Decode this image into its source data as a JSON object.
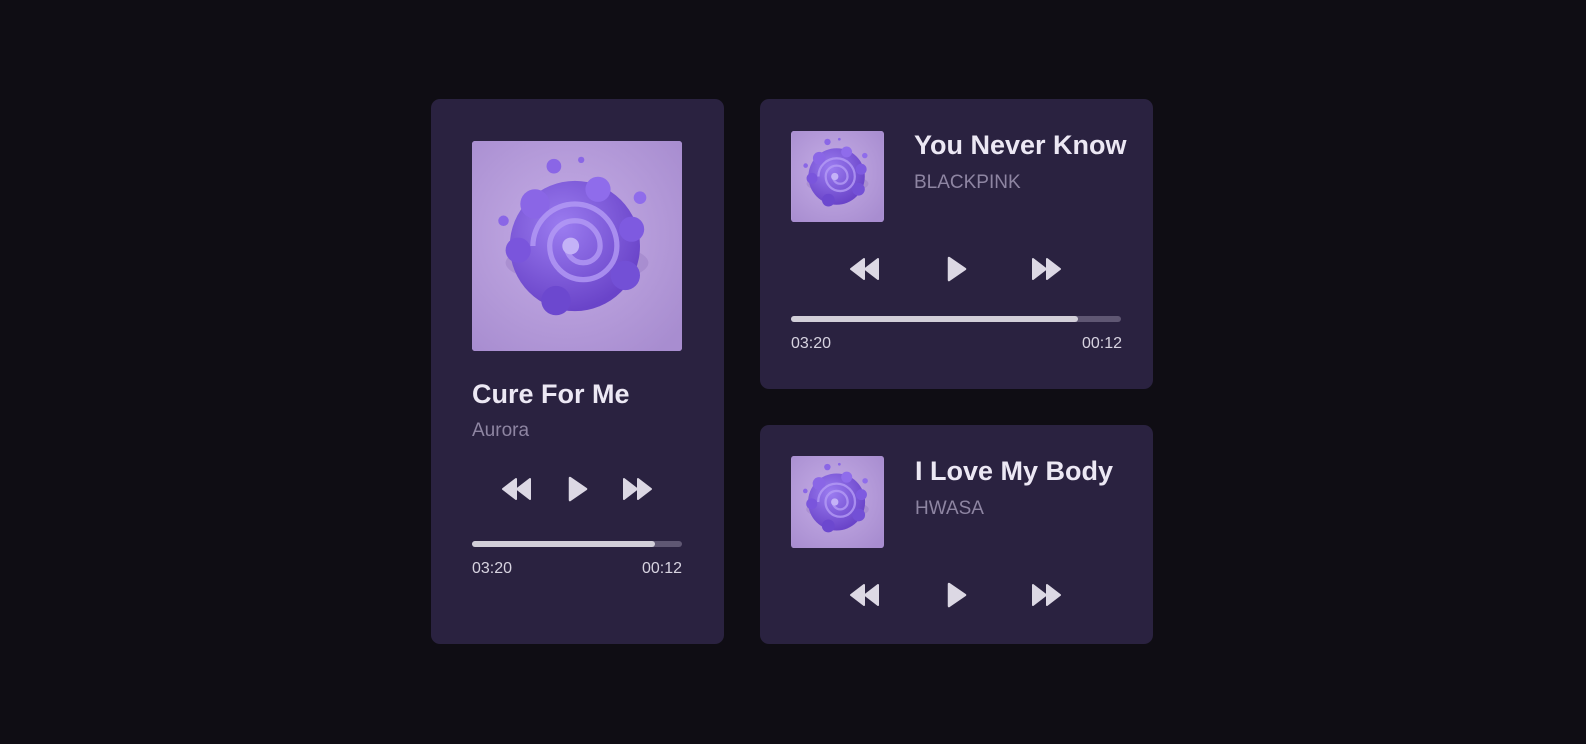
{
  "colors": {
    "background": "#0f0d14",
    "card": "#2a2240",
    "title": "#ece8f4",
    "artist": "#8e85a2",
    "progress_fill": "#d2cfd9",
    "progress_track": "#5f5773",
    "art": "#b9a0dc"
  },
  "players": [
    {
      "title": "Cure For Me",
      "artist": "Aurora",
      "art_icon": "purple-swirl-album-art",
      "controls": [
        "rewind-icon",
        "play-icon",
        "fast-forward-icon"
      ],
      "progress": 0.87,
      "time_left": "03:20",
      "time_right": "00:12"
    },
    {
      "title": "You Never Know",
      "artist": "BLACKPINK",
      "art_icon": "purple-swirl-album-art",
      "controls": [
        "rewind-icon",
        "play-icon",
        "fast-forward-icon"
      ],
      "progress": 0.87,
      "time_left": "03:20",
      "time_right": "00:12"
    },
    {
      "title": "I Love My Body",
      "artist": "HWASA",
      "art_icon": "purple-swirl-album-art",
      "controls": [
        "rewind-icon",
        "play-icon",
        "fast-forward-icon"
      ]
    }
  ]
}
